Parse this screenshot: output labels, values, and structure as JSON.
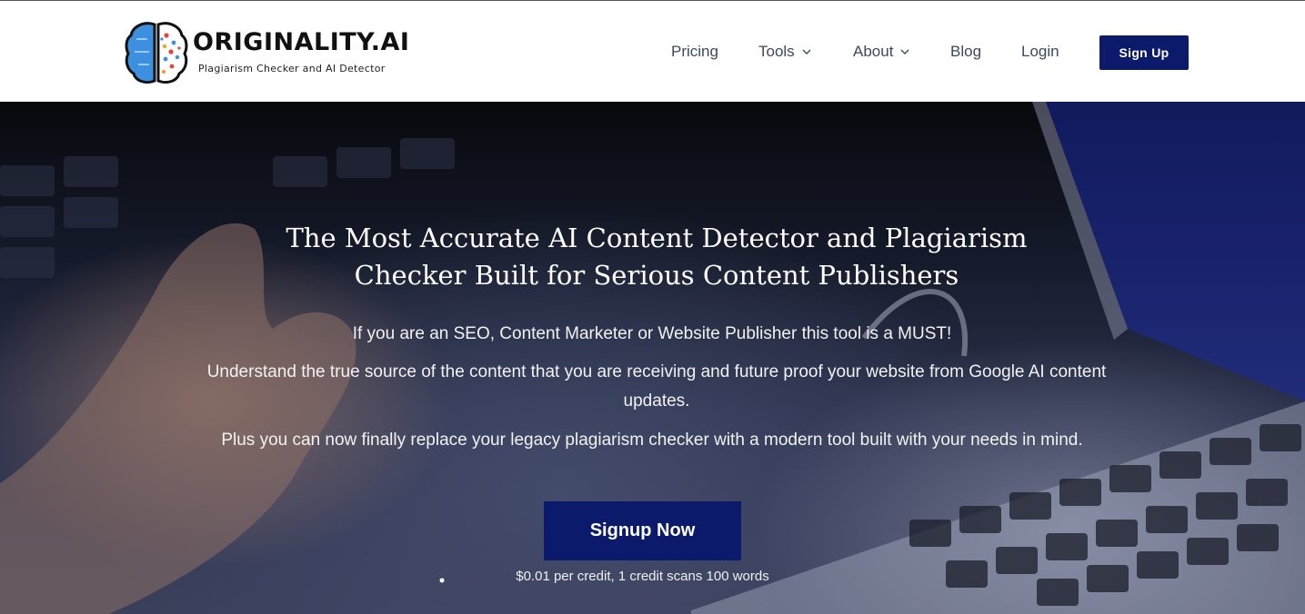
{
  "brand": {
    "name": "ORIGINALITY.AI",
    "tagline": "Plagiarism Checker and AI Detector"
  },
  "nav": {
    "items": [
      {
        "label": "Pricing",
        "dropdown": false
      },
      {
        "label": "Tools",
        "dropdown": true
      },
      {
        "label": "About",
        "dropdown": true
      },
      {
        "label": "Blog",
        "dropdown": false
      },
      {
        "label": "Login",
        "dropdown": false
      }
    ],
    "signup_label": "Sign Up"
  },
  "hero": {
    "headline_line1": "The Most Accurate AI Content Detector and Plagiarism",
    "headline_line2": "Checker Built for Serious Content Publishers",
    "paragraph1": "If you are an SEO, Content Marketer or Website Publisher this tool is a MUST!",
    "paragraph2": "Understand the true source of the content that you are receiving and future proof your website from Google AI content updates.",
    "paragraph3": "Plus you can now finally replace your legacy plagiarism checker with a modern tool built with your needs in mind.",
    "cta_label": "Signup Now",
    "price_note": "$0.01 per credit, 1 credit scans 100 words"
  },
  "colors": {
    "accent": "#0b1a6b",
    "nav_text": "#3a4a5f",
    "brain_left": "#3d8fe0",
    "brain_dots": [
      "#e0463a",
      "#3d8fe0",
      "#f0a030"
    ]
  },
  "icons": {
    "logo": "brain-icon",
    "dropdown": "chevron-down-icon"
  }
}
